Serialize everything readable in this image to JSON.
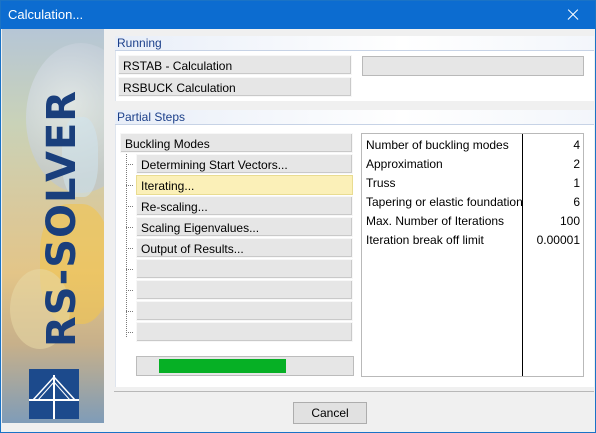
{
  "window": {
    "title": "Calculation..."
  },
  "banner": {
    "text": "RS-SOLVER"
  },
  "running": {
    "header": "Running",
    "items": [
      {
        "label": "RSTAB - Calculation"
      },
      {
        "label": "RSBUCK Calculation"
      }
    ]
  },
  "partial_steps": {
    "header": "Partial Steps",
    "root": "Buckling Modes",
    "steps": [
      {
        "label": "Determining Start Vectors..."
      },
      {
        "label": "Iterating..."
      },
      {
        "label": "Re-scaling..."
      },
      {
        "label": "Scaling Eigenvalues..."
      },
      {
        "label": "Output of Results..."
      }
    ],
    "active_step": "Iterating...",
    "progress_fraction": 0.65
  },
  "parameters": [
    {
      "label": "Number of buckling modes",
      "value": "4"
    },
    {
      "label": "Approximation",
      "value": "2"
    },
    {
      "label": "Truss",
      "value": "1"
    },
    {
      "label": "Tapering or elastic foundation",
      "value": "6"
    },
    {
      "label": "Max. Number of Iterations",
      "value": "100"
    },
    {
      "label": "Iteration break off limit",
      "value": "0.00001"
    }
  ],
  "buttons": {
    "cancel": "Cancel"
  },
  "colors": {
    "title_bar": "#0c6cd0",
    "progress": "#06b025",
    "active_step": "#fbf0b8",
    "header_text": "#1b3f8a"
  },
  "icons": {
    "close": "close-icon",
    "logo": "bridge-logo-icon"
  }
}
